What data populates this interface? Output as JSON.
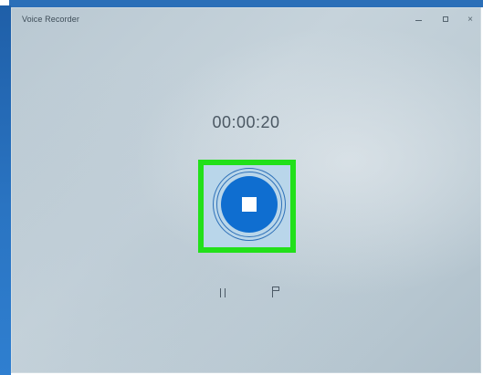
{
  "window": {
    "title": "Voice Recorder"
  },
  "recorder": {
    "elapsed_time": "00:00:20"
  },
  "icons": {
    "minimize": "minimize-icon",
    "maximize": "maximize-icon",
    "close": "close-icon",
    "close_glyph": "×",
    "stop": "stop-icon",
    "pause": "pause-icon",
    "flag": "flag-icon"
  },
  "colors": {
    "highlight": "#22e01a",
    "stop_button": "#0f6ed0",
    "desktop_blue": "#2a74c2"
  }
}
